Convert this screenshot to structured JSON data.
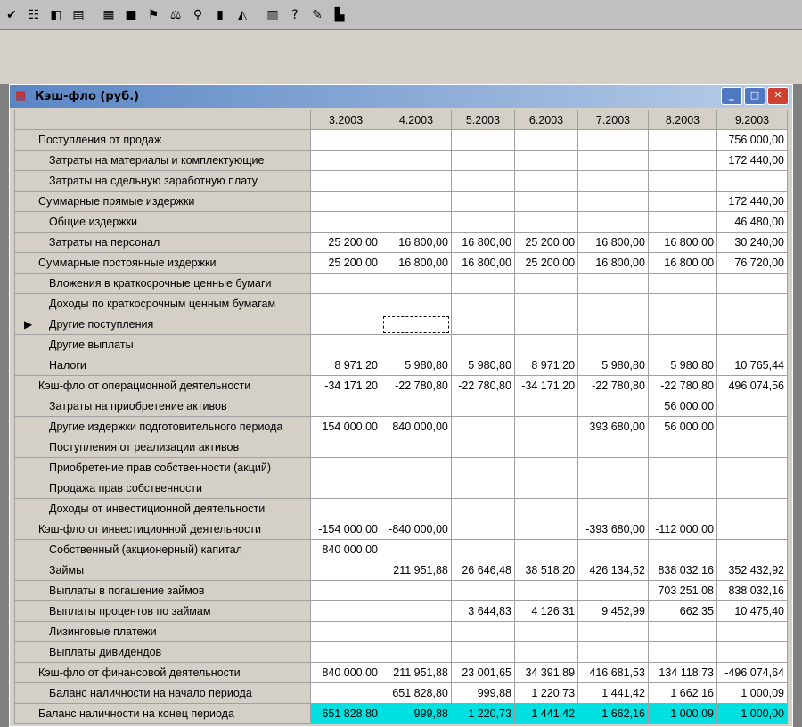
{
  "toolbar": {
    "icons": [
      "check-icon",
      "grid-icon",
      "window-icon",
      "doc-icon",
      "table-icon",
      "record-icon",
      "chart-flag-icon",
      "scales-icon",
      "search-doc-icon",
      "book-icon",
      "area-chart-icon",
      "report-icon",
      "npv-icon",
      "doc-edit-icon",
      "building-icon"
    ],
    "glyphs": [
      "✔",
      "☷",
      "◧",
      "▤",
      "▦",
      "■",
      "⚑",
      "⚖",
      "⚲",
      "▮",
      "◭",
      "▥",
      "?",
      "✎",
      "▙"
    ]
  },
  "window": {
    "title": "Кэш-фло (руб.)",
    "buttons": [
      "_",
      "□",
      "✕"
    ]
  },
  "grid": {
    "columns": [
      "",
      "3.2003",
      "4.2003",
      "5.2003",
      "6.2003",
      "7.2003",
      "8.2003",
      "9.2003"
    ],
    "rows": [
      {
        "label": "Поступления от продаж",
        "level": 1,
        "values": [
          "",
          "",
          "",
          "",
          "",
          "",
          "756 000,00"
        ]
      },
      {
        "label": "Затраты на материалы и комплектующие",
        "level": 2,
        "values": [
          "",
          "",
          "",
          "",
          "",
          "",
          "172 440,00"
        ]
      },
      {
        "label": "Затраты на сдельную заработную плату",
        "level": 2,
        "values": [
          "",
          "",
          "",
          "",
          "",
          "",
          ""
        ]
      },
      {
        "label": "Суммарные прямые издержки",
        "level": 1,
        "values": [
          "",
          "",
          "",
          "",
          "",
          "",
          "172 440,00"
        ]
      },
      {
        "label": "Общие издержки",
        "level": 2,
        "values": [
          "",
          "",
          "",
          "",
          "",
          "",
          "46 480,00"
        ]
      },
      {
        "label": "Затраты на персонал",
        "level": 2,
        "values": [
          "25 200,00",
          "16 800,00",
          "16 800,00",
          "25 200,00",
          "16 800,00",
          "16 800,00",
          "30 240,00"
        ]
      },
      {
        "label": "Суммарные постоянные издержки",
        "level": 1,
        "values": [
          "25 200,00",
          "16 800,00",
          "16 800,00",
          "25 200,00",
          "16 800,00",
          "16 800,00",
          "76 720,00"
        ]
      },
      {
        "label": "Вложения в краткосрочные ценные бумаги",
        "level": 2,
        "values": [
          "",
          "",
          "",
          "",
          "",
          "",
          ""
        ]
      },
      {
        "label": "Доходы по краткосрочным ценным бумагам",
        "level": 2,
        "values": [
          "",
          "",
          "",
          "",
          "",
          "",
          ""
        ]
      },
      {
        "label": "Другие поступления",
        "level": 2,
        "values": [
          "",
          "",
          "",
          "",
          "",
          "",
          ""
        ],
        "current": true
      },
      {
        "label": "Другие выплаты",
        "level": 2,
        "values": [
          "",
          "",
          "",
          "",
          "",
          "",
          ""
        ]
      },
      {
        "label": "Налоги",
        "level": 2,
        "values": [
          "8 971,20",
          "5 980,80",
          "5 980,80",
          "8 971,20",
          "5 980,80",
          "5 980,80",
          "10 765,44"
        ]
      },
      {
        "label": "Кэш-фло от операционной деятельности",
        "level": 1,
        "values": [
          "-34 171,20",
          "-22 780,80",
          "-22 780,80",
          "-34 171,20",
          "-22 780,80",
          "-22 780,80",
          "496 074,56"
        ]
      },
      {
        "label": "Затраты на приобретение активов",
        "level": 2,
        "values": [
          "",
          "",
          "",
          "",
          "",
          "56 000,00",
          ""
        ]
      },
      {
        "label": "Другие издержки подготовительного периода",
        "level": 2,
        "values": [
          "154 000,00",
          "840 000,00",
          "",
          "",
          "393 680,00",
          "56 000,00",
          ""
        ]
      },
      {
        "label": "Поступления от реализации активов",
        "level": 2,
        "values": [
          "",
          "",
          "",
          "",
          "",
          "",
          ""
        ]
      },
      {
        "label": "Приобретение прав собственности (акций)",
        "level": 2,
        "values": [
          "",
          "",
          "",
          "",
          "",
          "",
          ""
        ]
      },
      {
        "label": "Продажа прав собственности",
        "level": 2,
        "values": [
          "",
          "",
          "",
          "",
          "",
          "",
          ""
        ]
      },
      {
        "label": "Доходы от инвестиционной деятельности",
        "level": 2,
        "values": [
          "",
          "",
          "",
          "",
          "",
          "",
          ""
        ]
      },
      {
        "label": "Кэш-фло от инвестиционной деятельности",
        "level": 1,
        "values": [
          "-154 000,00",
          "-840 000,00",
          "",
          "",
          "-393 680,00",
          "-112 000,00",
          ""
        ]
      },
      {
        "label": "Собственный (акционерный) капитал",
        "level": 2,
        "values": [
          "840 000,00",
          "",
          "",
          "",
          "",
          "",
          ""
        ]
      },
      {
        "label": "Займы",
        "level": 2,
        "values": [
          "",
          "211 951,88",
          "26 646,48",
          "38 518,20",
          "426 134,52",
          "838 032,16",
          "352 432,92"
        ]
      },
      {
        "label": "Выплаты в погашение займов",
        "level": 2,
        "values": [
          "",
          "",
          "",
          "",
          "",
          "703 251,08",
          "838 032,16"
        ]
      },
      {
        "label": "Выплаты процентов по займам",
        "level": 2,
        "values": [
          "",
          "",
          "3 644,83",
          "4 126,31",
          "9 452,99",
          "662,35",
          "10 475,40"
        ]
      },
      {
        "label": "Лизинговые платежи",
        "level": 2,
        "values": [
          "",
          "",
          "",
          "",
          "",
          "",
          ""
        ]
      },
      {
        "label": "Выплаты дивидендов",
        "level": 2,
        "values": [
          "",
          "",
          "",
          "",
          "",
          "",
          ""
        ]
      },
      {
        "label": "Кэш-фло от финансовой деятельности",
        "level": 1,
        "values": [
          "840 000,00",
          "211 951,88",
          "23 001,65",
          "34 391,89",
          "416 681,53",
          "134 118,73",
          "-496 074,64"
        ]
      },
      {
        "label": "Баланс наличности на начало периода",
        "level": 2,
        "values": [
          "",
          "651 828,80",
          "999,88",
          "1 220,73",
          "1 441,42",
          "1 662,16",
          "1 000,09"
        ]
      },
      {
        "label": "Баланс наличности на конец периода",
        "level": 1,
        "values": [
          "651 828,80",
          "999,88",
          "1 220,73",
          "1 441,42",
          "1 662,16",
          "1 000,09",
          "1 000,00"
        ],
        "highlight": true
      }
    ]
  },
  "colors": {
    "highlight": "#00e0e0",
    "titlebar": "#5a86c4",
    "chrome": "#d4d0c8"
  }
}
